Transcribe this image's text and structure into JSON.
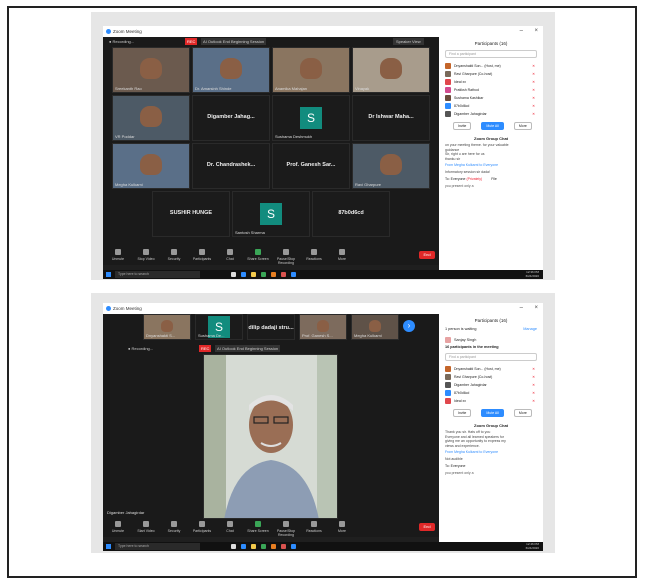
{
  "shot1": {
    "window_title": "Zoom Meeting",
    "recording": "Recording...",
    "rec_badge": "REC",
    "rec_text": "AI Outlook End Beginning Session",
    "speaker_view": "Speaker View",
    "tiles": [
      {
        "name": "Sreekanth Rao",
        "kind": "video"
      },
      {
        "name": "Dr. Amarsinh Shinde",
        "kind": "video"
      },
      {
        "name": "Anamika Mahajan",
        "kind": "video"
      },
      {
        "name": "Vinayak",
        "kind": "video"
      },
      {
        "name": "VR Poddar",
        "kind": "video"
      },
      {
        "name": "Digamber Jahag...",
        "kind": "name"
      },
      {
        "name": "Sushama Deshmukh",
        "kind": "initial",
        "initial": "S"
      },
      {
        "name": "Dr Ishwar Maha...",
        "kind": "name"
      },
      {
        "name": "Megha Kulkarni",
        "kind": "video"
      },
      {
        "name": "Dr. Chandrashek...",
        "kind": "name"
      },
      {
        "name": "Prof. Ganesh Sar...",
        "kind": "name"
      },
      {
        "name": "Ravi Gharpure",
        "kind": "video"
      },
      {
        "name": "SUSHIR HUNGE",
        "kind": "name"
      },
      {
        "name": "Santosh Sharma",
        "kind": "initial",
        "initial": "S"
      },
      {
        "name": "87b0d6cd",
        "kind": "name"
      }
    ],
    "toolbar": [
      "Unmute",
      "Stop Video",
      "Security",
      "Participants",
      "Chat",
      "Share Screen",
      "Pause/Stop Recording",
      "Reactions",
      "More"
    ],
    "end": "End",
    "taskbar_search": "Type here to search",
    "clock": [
      "12:36 PM",
      "6/24/2020"
    ],
    "participants_header": "Participants (16)",
    "find": "Find a participant",
    "participants": [
      {
        "name": "Dnyanshakti Son... (Host, me)",
        "color": "#c4652a"
      },
      {
        "name": "Ravi Gharpure (Co-host)",
        "color": "#7a6a5a"
      },
      {
        "name": "Ideal xx",
        "color": "#e0474c"
      },
      {
        "name": "Pratiksh Rathod",
        "color": "#d24c8f"
      },
      {
        "name": "Sushama Kashikar",
        "color": "#6b4c3b"
      },
      {
        "name": "87b0d6cd",
        "color": "#2d8cff"
      },
      {
        "name": "Digamber Jahagirdar",
        "color": "#555"
      }
    ],
    "invite": "Invite",
    "mute_all": "Mute All",
    "more": "More",
    "chat_title": "Zoom Group Chat",
    "chat_lines": [
      "on your meeting theme. for your valuable",
      "guidance",
      "Sir, right u are here for us",
      "thanku sir"
    ],
    "chat_from": "From Megha Kulkarni to Everyone",
    "chat_msg": "Informatory session sir dada!",
    "chat_to": "To:",
    "chat_to_val": "Everyone",
    "chat_priv": "(Privately)",
    "chat_file": "File",
    "chat_typed": "you present only a"
  },
  "shot2": {
    "window_title": "Zoom Meeting",
    "recording": "Recording...",
    "rec_badge": "REC",
    "rec_text": "AI Outlook End Beginning Session",
    "strip": [
      {
        "name": "Dnyanshakti S...",
        "kind": "video"
      },
      {
        "name": "Sushama De...",
        "kind": "initial",
        "initial": "S"
      },
      {
        "name": "dilip dadaji stru...",
        "kind": "name"
      },
      {
        "name": "Prof. Ganesh S...",
        "kind": "video"
      },
      {
        "name": "Megha Kulkarni",
        "kind": "video"
      }
    ],
    "main_name": "Digamber Jahagirdar",
    "toolbar": [
      "Unmute",
      "Start Video",
      "Security",
      "Participants",
      "Chat",
      "Share Screen",
      "Pause/Stop Recording",
      "Reactions",
      "More"
    ],
    "end": "End",
    "taskbar_search": "Type here to search",
    "clock": [
      "12:46 PM",
      "6/24/2020"
    ],
    "participants_header": "Participants (16)",
    "waiting": "1 person is waiting",
    "manage": "Manage",
    "waiting_name": "Sanjay Singh",
    "in_meeting": "16 participants in the meeting",
    "find": "Find a participant",
    "participants": [
      {
        "name": "Dnyanshakti Son... (Host, me)",
        "color": "#c4652a"
      },
      {
        "name": "Ravi Gharpure (Co-host)",
        "color": "#7a6a5a"
      },
      {
        "name": "Digamber Jahagirdar",
        "color": "#555"
      },
      {
        "name": "87b0d6cd",
        "color": "#2d8cff"
      },
      {
        "name": "Ideal xx",
        "color": "#e0474c"
      }
    ],
    "invite": "Invite",
    "mute_all": "Mute All",
    "more": "More",
    "chat_title": "Zoom Group Chat",
    "chat_lines": [
      "Thank you sir. Hats off to you",
      "Everyone and all learned speakers for",
      "giving me an opportunity to express my",
      "views and experience."
    ],
    "chat_from": "From Megha Kulkarni to Everyone",
    "chat_msg": "Not audible",
    "chat_to": "To:",
    "chat_to_val": "Everyone",
    "chat_typed": "you present only a"
  }
}
